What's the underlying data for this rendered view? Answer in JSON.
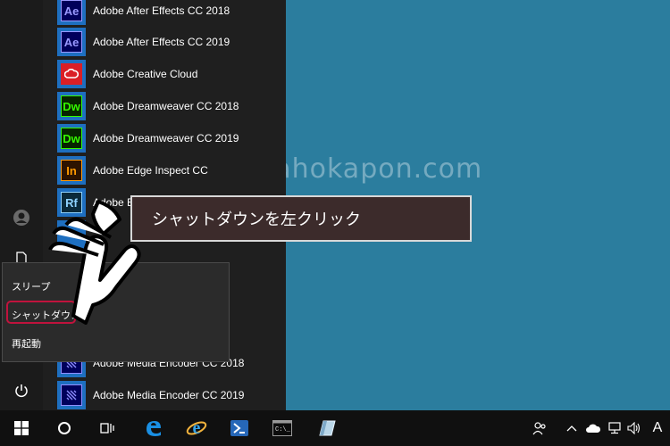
{
  "watermark": "hokahokapon.com",
  "apps": [
    {
      "abbr": "Ae",
      "name": "Adobe After Effects CC 2018",
      "color": "#9999ff",
      "bg": "#00005b"
    },
    {
      "abbr": "Ae",
      "name": "Adobe After Effects CC 2019",
      "color": "#9999ff",
      "bg": "#00005b"
    },
    {
      "abbr": "",
      "name": "Adobe Creative Cloud",
      "color": "#ffffff",
      "bg": "#da1f26"
    },
    {
      "abbr": "Dw",
      "name": "Adobe Dreamweaver CC 2018",
      "color": "#35fa00",
      "bg": "#072401"
    },
    {
      "abbr": "Dw",
      "name": "Adobe Dreamweaver CC 2019",
      "color": "#35fa00",
      "bg": "#072401"
    },
    {
      "abbr": "In",
      "name": "Adobe Edge Inspect CC",
      "color": "#ff9a00",
      "bg": "#2d1300"
    },
    {
      "abbr": "Rf",
      "name": "Adobe E",
      "color": "#8fd3ff",
      "bg": "#0b2a3a"
    },
    {
      "abbr": "",
      "name": "",
      "color": "#ffffff",
      "bg": "#1e6fc0"
    },
    {
      "abbr": "",
      "name": "",
      "color": "#ffffff",
      "bg": "#1e6fc0"
    },
    {
      "abbr": "",
      "name": "",
      "color": "#ffffff",
      "bg": "#1e6fc0"
    },
    {
      "abbr": "",
      "name": "",
      "color": "#ffffff",
      "bg": "#1e6fc0"
    },
    {
      "abbr": "",
      "name": "Adobe Media Encoder CC 2018",
      "color": "#8f8fff",
      "bg": "#00005b"
    },
    {
      "abbr": "",
      "name": "Adobe Media Encoder CC 2019",
      "color": "#8f8fff",
      "bg": "#00005b"
    }
  ],
  "power_menu": {
    "sleep": "スリープ",
    "shutdown": "シャットダウン",
    "restart": "再起動"
  },
  "callout": "シャットダウンを左クリック",
  "rail": {
    "user_icon": "user-icon",
    "documents_icon": "document-icon",
    "power_icon": "power-icon"
  },
  "taskbar": {
    "apps": [
      "start-icon",
      "cortana-icon",
      "task-view-icon",
      "edge-icon",
      "internet-explorer-icon",
      "powershell-icon",
      "command-prompt-icon",
      "unknown-app-icon"
    ],
    "ime": "A"
  },
  "colors": {
    "desktop": "#2b7d9e",
    "start_panel": "#1f1f1f",
    "tile": "#1e6fc0",
    "highlight": "#c0133d"
  }
}
